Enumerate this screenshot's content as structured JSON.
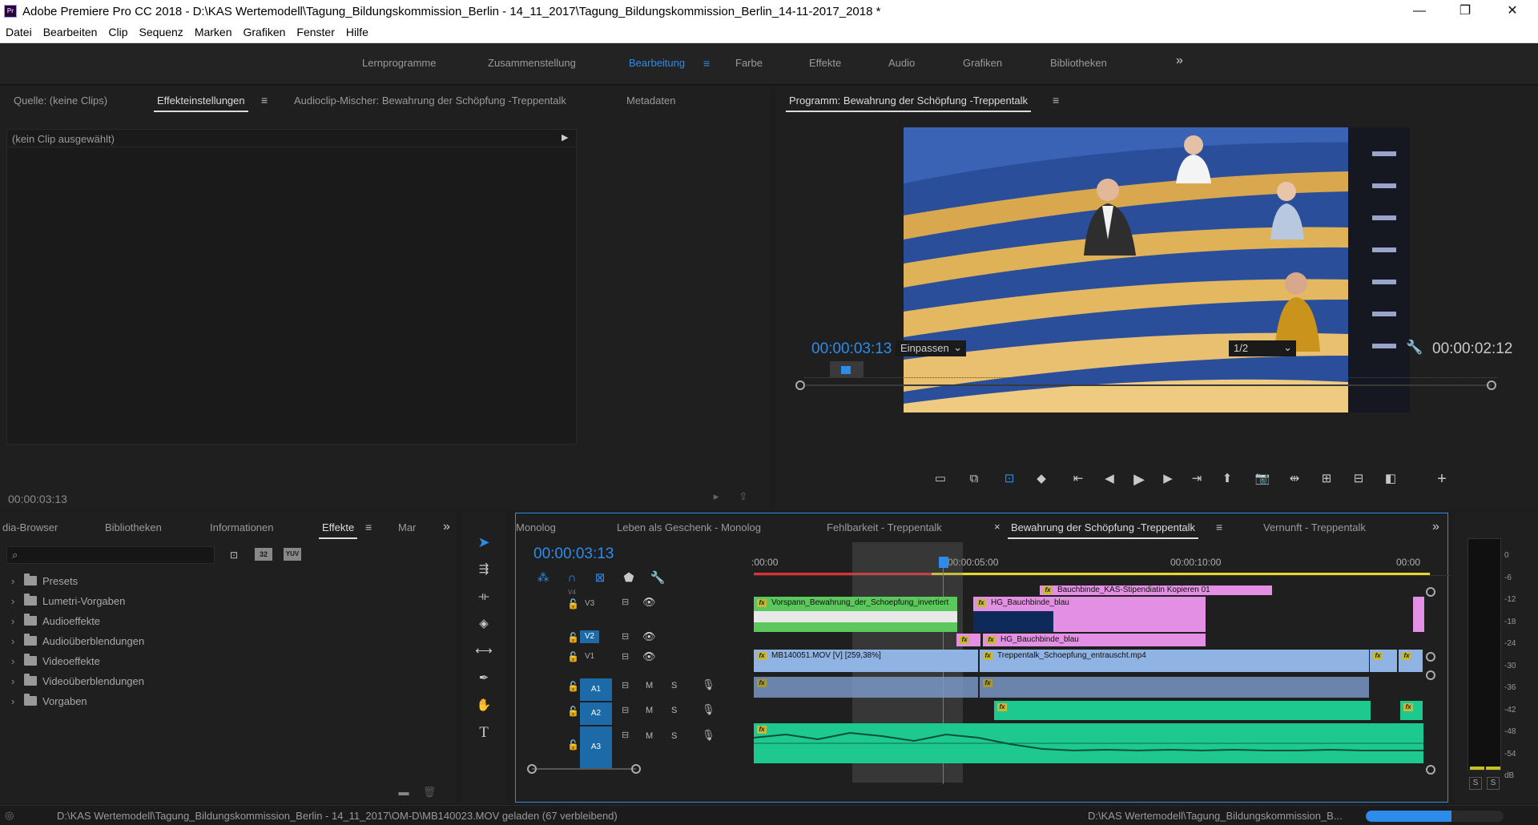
{
  "app": {
    "logo": "Pr",
    "title": "Adobe Premiere Pro CC 2018 - D:\\KAS Wertemodell\\Tagung_Bildungskommission_Berlin - 14_11_2017\\Tagung_Bildungskommission_Berlin_14-11-2017_2018 *",
    "minimize": "—",
    "maximize": "❐",
    "close": "✕"
  },
  "menu": [
    "Datei",
    "Bearbeiten",
    "Clip",
    "Sequenz",
    "Marken",
    "Grafiken",
    "Fenster",
    "Hilfe"
  ],
  "workspaces": {
    "items": [
      "Lernprogramme",
      "Zusammenstellung",
      "Bearbeitung",
      "Farbe",
      "Effekte",
      "Audio",
      "Grafiken",
      "Bibliotheken"
    ],
    "active": "Bearbeitung",
    "more": "»"
  },
  "source_panel": {
    "tabs": [
      "Quelle: (keine Clips)",
      "Effekteinstellungen",
      "Audioclip-Mischer: Bewahrung der Schöpfung -Treppentalk",
      "Metadaten"
    ],
    "no_clip": "(kein Clip ausgewählt)",
    "timecode": "00:00:03:13"
  },
  "program_monitor": {
    "title": "Programm: Bewahrung der Schöpfung -Treppentalk",
    "timecode": "00:00:03:13",
    "fit": "Einpassen",
    "resolution": "1/2",
    "duration": "00:00:02:12"
  },
  "effects_panel": {
    "tabs": [
      "dia-Browser",
      "Bibliotheken",
      "Informationen",
      "Effekte",
      "Mar"
    ],
    "active": "Effekte",
    "badges": [
      "32",
      "YUV"
    ],
    "tree": [
      "Presets",
      "Lumetri-Vorgaben",
      "Audioeffekte",
      "Audioüberblendungen",
      "Videoeffekte",
      "Videoüberblendungen",
      "Vorgaben"
    ]
  },
  "tools": [
    "selection-tool",
    "track-select-tool",
    "ripple-edit-tool",
    "razor-tool",
    "slip-tool",
    "pen-tool",
    "hand-tool",
    "type-tool"
  ],
  "tools_text": "T",
  "timeline": {
    "tabs": [
      "Monolog",
      "Leben als Geschenk - Monolog",
      "Fehlbarkeit - Treppentalk",
      "Bewahrung der Schöpfung -Treppentalk",
      "Vernunft - Treppentalk"
    ],
    "active": "Bewahrung der Schöpfung -Treppentalk",
    "close_mark": "×",
    "timecode": "00:00:03:13",
    "ruler": [
      ":00:00",
      "00:00:05:00",
      "00:00:10:00",
      "00:00"
    ],
    "tracks": [
      {
        "label": "V4"
      },
      {
        "label": "V3"
      },
      {
        "label": "V2"
      },
      {
        "label": "V1"
      },
      {
        "label": "A1"
      },
      {
        "label": "A2"
      },
      {
        "label": "A3"
      }
    ],
    "mute": "M",
    "solo": "S",
    "clips": {
      "bauchbinde_top": "Bauchbinde_KAS-Stipendiatin Kopieren 01",
      "vorspann": "Vorspann_Bewahrung_der_Schoepfung_invertiert",
      "hg1": "HG_Bauchbinde_blau",
      "hg2": "HG_Bauchbinde_blau",
      "mb": "MB140051.MOV [V] [259,38%]",
      "treppentalk": "Treppentalk_Schoepfung_entrauscht.mp4"
    },
    "fx": "fx"
  },
  "meter": {
    "scale": [
      "0",
      "-6",
      "-12",
      "-18",
      "-24",
      "-30",
      "-36",
      "-42",
      "-48",
      "-54",
      "dB"
    ],
    "solo_buttons": [
      "S",
      "S"
    ]
  },
  "status": {
    "message": "D:\\KAS Wertemodell\\Tagung_Bildungskommission_Berlin - 14_11_2017\\OM-D\\MB140023.MOV geladen (67 verbleibend)",
    "right": "D:\\KAS Wertemodell\\Tagung_Bildungskommission_B...",
    "progress": 0.62
  },
  "colors": {
    "accent": "#2d8ceb",
    "video_clip": "#8fb3e3",
    "graphic_clip": "#e38fe3",
    "green_clip": "#5ac85a",
    "audio_clip": "#1ec990"
  }
}
